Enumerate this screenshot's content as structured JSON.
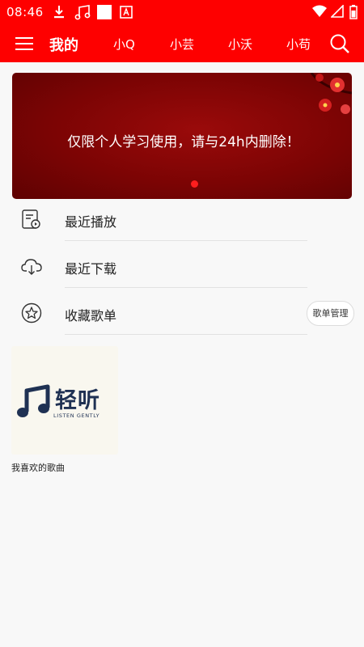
{
  "status_bar": {
    "time": "08:46"
  },
  "app_bar": {
    "tabs": [
      {
        "label": "我的",
        "active": true
      },
      {
        "label": "小Q",
        "active": false
      },
      {
        "label": "小芸",
        "active": false
      },
      {
        "label": "小沃",
        "active": false
      },
      {
        "label": "小苟",
        "active": false
      }
    ]
  },
  "banner": {
    "text": "仅限个人学习使用，请与24h内删除！",
    "slide_count": 1,
    "active_slide": 1
  },
  "menu": {
    "recent_play": "最近播放",
    "recent_download": "最近下载",
    "favorite_playlists": "收藏歌单",
    "manage_playlists": "歌单管理"
  },
  "playlists": [
    {
      "name": "我喜欢的歌曲",
      "logo_cn": "轻听",
      "logo_en": "LISTEN GENTLY"
    }
  ],
  "colors": {
    "brand_red": "#fe0000",
    "banner_red": "#7c0404",
    "logo_navy": "#1f3153",
    "background": "#f8f8f8"
  }
}
